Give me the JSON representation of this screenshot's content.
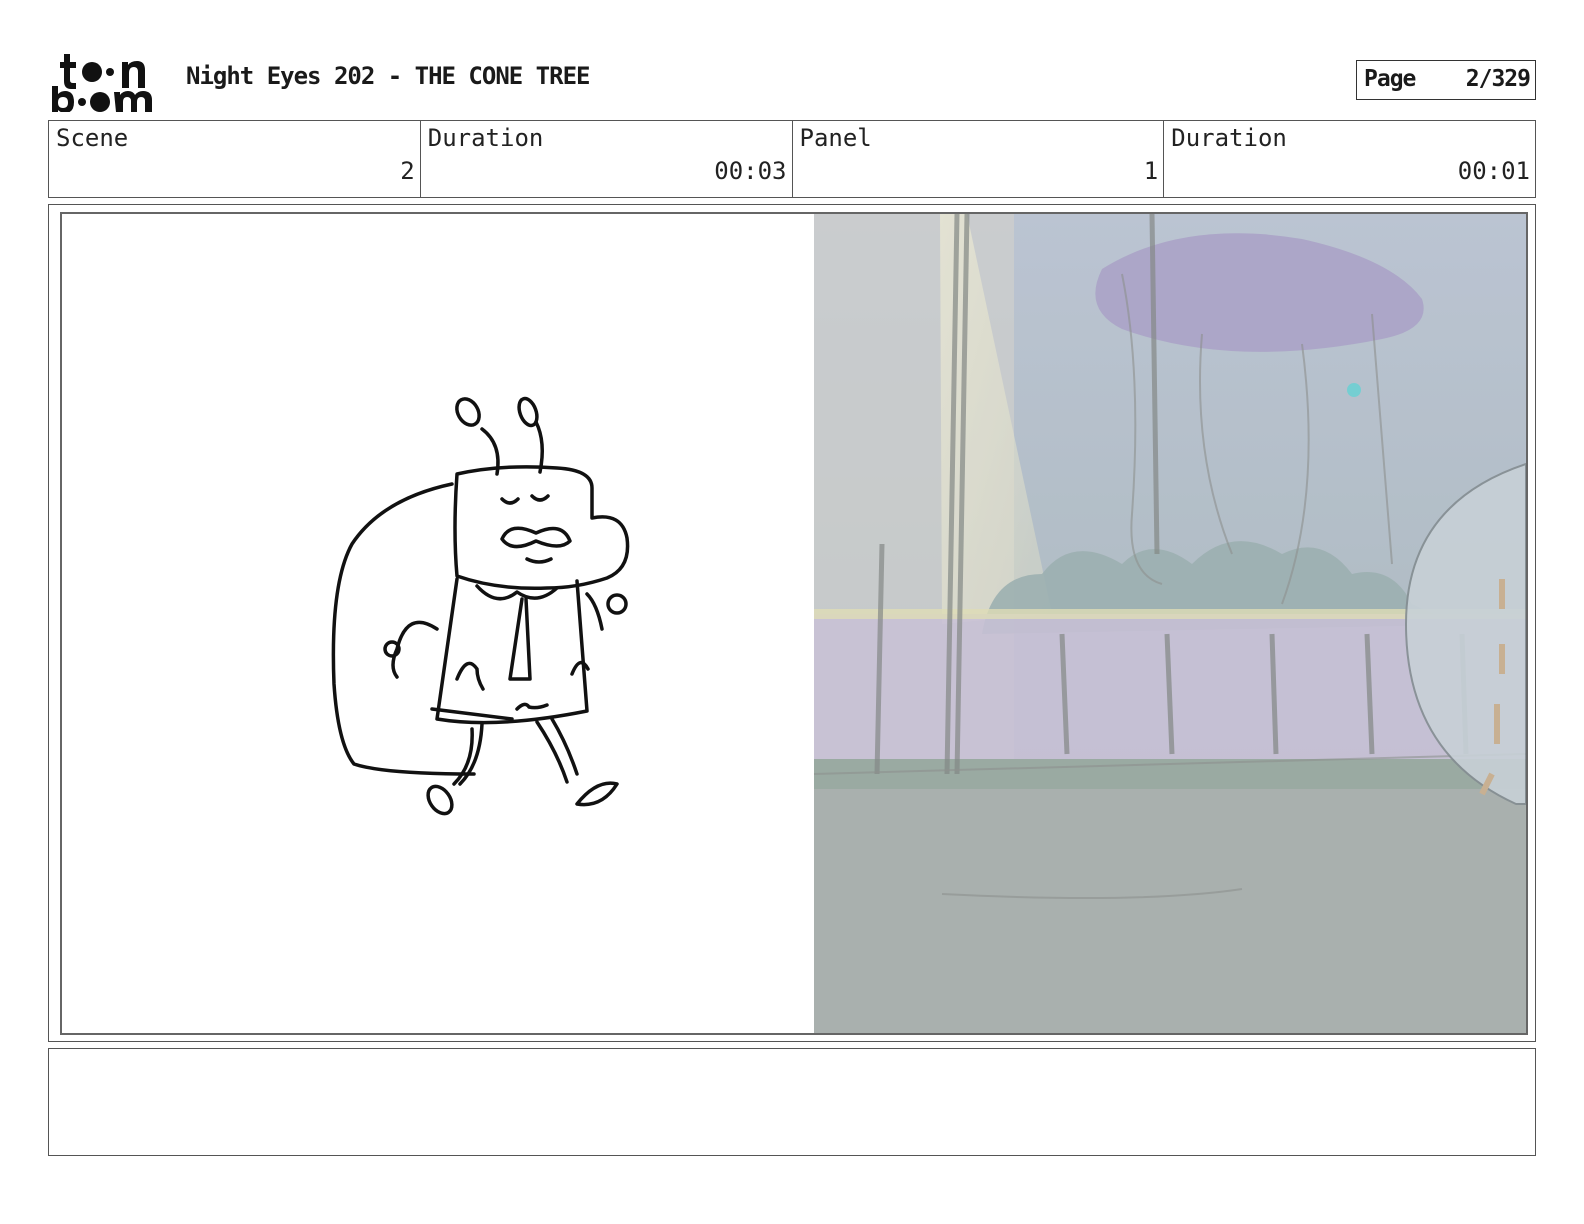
{
  "header": {
    "logo_text": "toon boom",
    "title": "Night Eyes 202 - THE CONE TREE",
    "page_label": "Page",
    "page_number": "2/329"
  },
  "info": {
    "scene_label": "Scene",
    "scene_value": "2",
    "scene_duration_label": "Duration",
    "scene_duration_value": "00:03",
    "panel_label": "Panel",
    "panel_value": "1",
    "panel_duration_label": "Duration",
    "panel_duration_value": "00:01"
  },
  "notes": {
    "text": ""
  }
}
